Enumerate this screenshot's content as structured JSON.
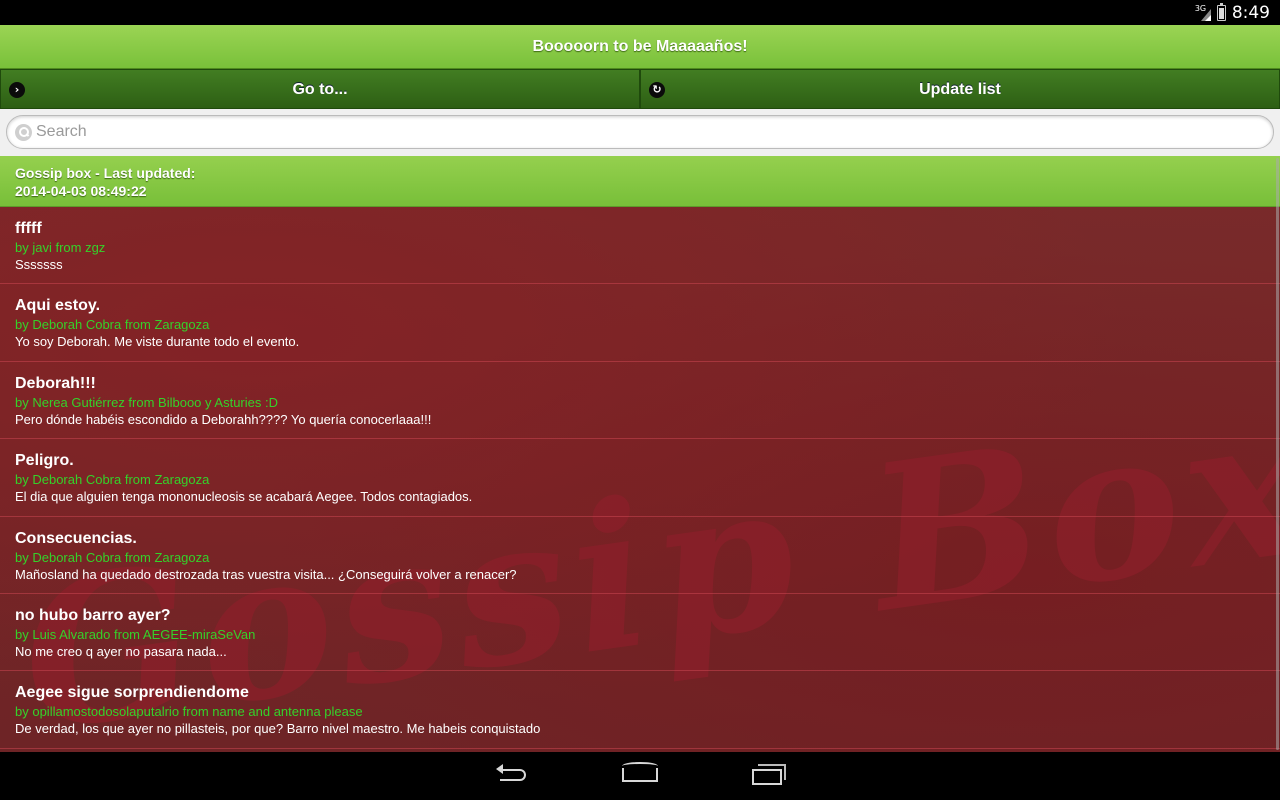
{
  "status_bar": {
    "network": "3G",
    "time": "8:49"
  },
  "header": {
    "title": "Booooorn to be Maaaaaños!"
  },
  "navbar": {
    "goto_label": "Go to...",
    "goto_icon": "chevron-right-icon",
    "update_label": "Update list",
    "update_icon": "refresh-icon"
  },
  "search": {
    "placeholder": "Search",
    "value": ""
  },
  "list": {
    "header_line1": "Gossip box - Last updated:",
    "header_line2": "2014-04-03 08:49:22",
    "watermark": "Gossip Box",
    "entries": [
      {
        "title": "fffff",
        "author": "by javi from zgz",
        "text": "Sssssss"
      },
      {
        "title": "Aqui estoy.",
        "author": "by Deborah Cobra from Zaragoza",
        "text": "Yo soy Deborah. Me viste durante todo el evento."
      },
      {
        "title": "Deborah!!!",
        "author": "by Nerea Gutiérrez from Bilbooo y Asturies :D",
        "text": "Pero dónde habéis escondido a Deborahh???? Yo quería conocerlaaa!!!"
      },
      {
        "title": "Peligro.",
        "author": "by Deborah Cobra from Zaragoza",
        "text": "El dia que alguien tenga mononucleosis se acabará Aegee. Todos contagiados."
      },
      {
        "title": "Consecuencias.",
        "author": "by Deborah Cobra from Zaragoza",
        "text": "Mañosland ha quedado destrozada tras vuestra visita... ¿Conseguirá volver a renacer?"
      },
      {
        "title": "no hubo barro ayer?",
        "author": "by Luis Alvarado from AEGEE-miraSeVan",
        "text": "No me creo q ayer no pasara nada..."
      },
      {
        "title": "Aegee sigue sorprendiendome",
        "author": "by opillamostodosolaputalrio from name and antenna please",
        "text": "De verdad, los que ayer no pillasteis, por que? Barro nivel maestro. Me habeis conquistado"
      }
    ]
  },
  "system_nav": {
    "back_icon": "back-icon",
    "home_icon": "home-icon",
    "recent_icon": "recent-apps-icon"
  },
  "colors": {
    "header_green": "#8bcb46",
    "navbar_green": "#3a731c",
    "author_green": "#35d12a",
    "list_bg": "#722628"
  }
}
